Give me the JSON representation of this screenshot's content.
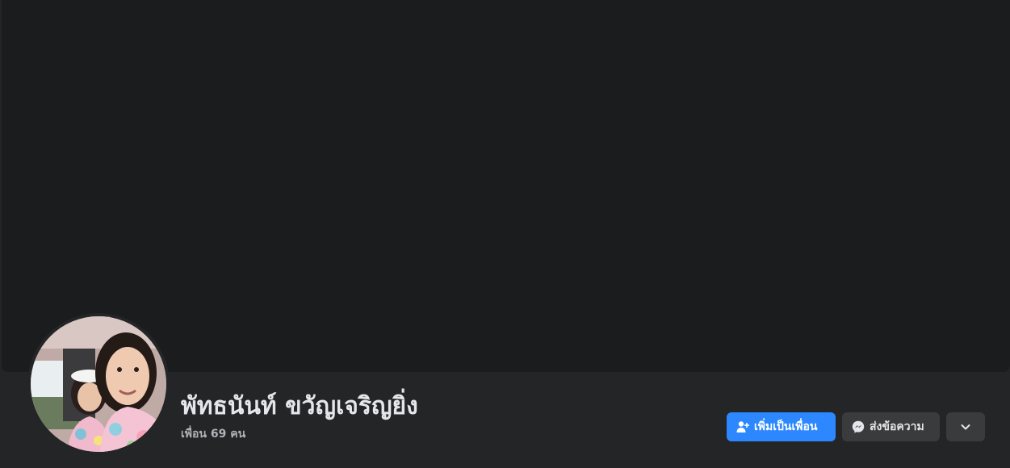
{
  "profile": {
    "name": "พัทธนันท์ ขวัญเจริญยิ่ง",
    "friends_count_text": "เพื่อน 69 คน"
  },
  "actions": {
    "add_friend_label": "เพิ่มเป็นเพื่อน",
    "message_label": "ส่งข้อความ"
  },
  "icons": {
    "add_friend": "add-user-icon",
    "messenger": "messenger-icon",
    "more": "chevron-down-icon"
  },
  "colors": {
    "page_background": "#242526",
    "cover_background": "#1b1c1e",
    "primary_button": "#2d88ff",
    "secondary_button": "#3a3b3c",
    "text_primary": "#e4e6eb",
    "text_secondary": "#b0b3b8"
  }
}
